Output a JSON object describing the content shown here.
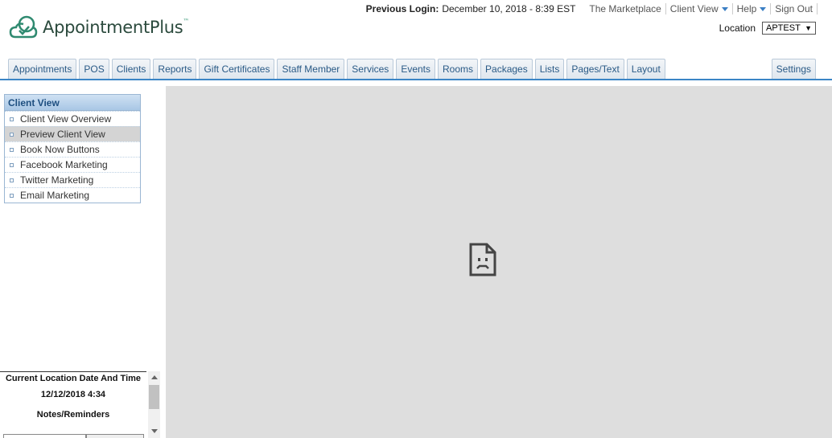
{
  "brand": {
    "logo_icon": "cloud-check-logo",
    "name": "AppointmentPlus",
    "tm": "™"
  },
  "header": {
    "login_label": "Previous Login:",
    "login_value": "December 10, 2018 - 8:39 EST",
    "links": [
      "The Marketplace",
      "Client View",
      "Help",
      "Sign Out"
    ],
    "location_label": "Location",
    "location_value": "APTEST"
  },
  "tabs": [
    "Appointments",
    "POS",
    "Clients",
    "Reports",
    "Gift Certificates",
    "Staff Member",
    "Services",
    "Events",
    "Rooms",
    "Packages",
    "Lists",
    "Pages/Text",
    "Layout"
  ],
  "settings_tab": "Settings",
  "sidebar": {
    "title": "Client View",
    "items": [
      "Client View Overview",
      "Preview Client View",
      "Book Now Buttons",
      "Facebook Marketing",
      "Twitter Marketing",
      "Email Marketing"
    ],
    "active_index": 1
  },
  "main": {
    "icon": "broken-page-icon"
  },
  "bottom_panel": {
    "title": "Current Location Date And Time",
    "datetime": "12/12/2018 4:34",
    "notes_title": "Notes/Reminders"
  },
  "colors": {
    "accent": "#3b85c6",
    "brand_green": "#3a9a7a",
    "main_bg": "#dedede"
  }
}
